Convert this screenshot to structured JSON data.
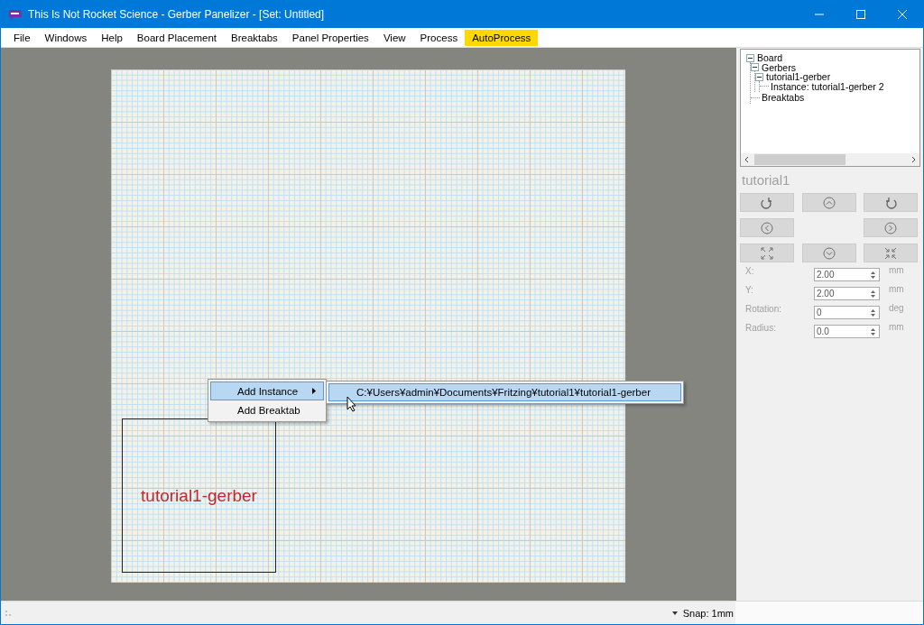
{
  "window": {
    "title": "This Is Not Rocket Science - Gerber Panelizer - [Set: Untitled]"
  },
  "menu": [
    {
      "label": "File",
      "highlighted": false
    },
    {
      "label": "Windows",
      "highlighted": false
    },
    {
      "label": "Help",
      "highlighted": false
    },
    {
      "label": "Board Placement",
      "highlighted": false
    },
    {
      "label": "Breaktabs",
      "highlighted": false
    },
    {
      "label": "Panel Properties",
      "highlighted": false
    },
    {
      "label": "View",
      "highlighted": false
    },
    {
      "label": "Process",
      "highlighted": false
    },
    {
      "label": "AutoProcess",
      "highlighted": true
    }
  ],
  "canvas": {
    "board_label": "tutorial1-gerber",
    "context_menu": [
      {
        "label": "Add Instance",
        "selected": true,
        "submenu": true
      },
      {
        "label": "Add Breaktab",
        "selected": false,
        "submenu": false
      }
    ],
    "submenu": [
      {
        "label": "C:¥Users¥admin¥Documents¥Fritzing¥tutorial1¥tutorial1-gerber",
        "selected": true
      }
    ]
  },
  "tree": [
    {
      "label": "Board",
      "expanded": true,
      "children": [
        {
          "label": "Gerbers",
          "expanded": true,
          "children": [
            {
              "label": "tutorial1-gerber",
              "expanded": true,
              "children": [
                {
                  "label": "Instance: tutorial1-gerber 2"
                }
              ]
            }
          ]
        },
        {
          "label": "Breaktabs"
        }
      ]
    }
  ],
  "properties": {
    "disabled": true,
    "title": "tutorial1",
    "fields": [
      {
        "label": "X:",
        "value": "2.00",
        "unit": "mm"
      },
      {
        "label": "Y:",
        "value": "2.00",
        "unit": "mm"
      },
      {
        "label": "Rotation:",
        "value": "0",
        "unit": "deg"
      },
      {
        "label": "Radius:",
        "value": "0.0",
        "unit": "mm"
      }
    ]
  },
  "status_bar": {
    "snap": "Snap: 1mm"
  }
}
